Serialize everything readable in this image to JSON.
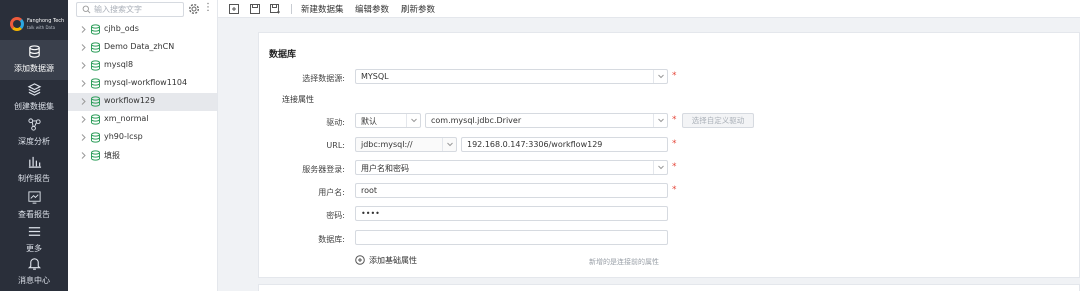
{
  "logo": {
    "name": "Fanghong Tech",
    "tagline": "talk with Data"
  },
  "nav": [
    {
      "label": "添加数据源",
      "icon": "database-icon",
      "active": true
    },
    {
      "label": "创建数据集",
      "icon": "layers-icon"
    },
    {
      "label": "深度分析",
      "icon": "network-icon"
    },
    {
      "label": "制作报告",
      "icon": "report-icon"
    },
    {
      "label": "查看报告",
      "icon": "chart-monitor-icon"
    },
    {
      "label": "更多",
      "icon": "menu-icon"
    },
    {
      "label": "消息中心",
      "icon": "bell-icon"
    }
  ],
  "tree": {
    "search_placeholder": "输入搜索文字",
    "more": "⋮",
    "items": [
      {
        "label": "cjhb_ods"
      },
      {
        "label": "Demo Data_zhCN"
      },
      {
        "label": "mysql8"
      },
      {
        "label": "mysql-workflow1104"
      },
      {
        "label": "workflow129",
        "selected": true
      },
      {
        "label": "xm_normal"
      },
      {
        "label": "yh90-lcsp"
      },
      {
        "label": "填报"
      }
    ]
  },
  "toolbar": {
    "new_dataset": "新建数据集",
    "edit_params": "编辑参数",
    "refresh_params": "刷新参数"
  },
  "form": {
    "title": "数据库",
    "section": "连接属性",
    "datasource_label": "选择数据源:",
    "datasource_value": "MYSQL",
    "driver_label": "驱动:",
    "driver_mode": "默认",
    "driver_class": "com.mysql.jdbc.Driver",
    "custom_driver_button": "选择自定义驱动",
    "url_label": "URL:",
    "url_prefix": "jdbc:mysql://",
    "url_value": "192.168.0.147:3306/workflow129",
    "login_label": "服务器登录:",
    "login_value": "用户名和密码",
    "username_label": "用户名:",
    "username_value": "root",
    "password_label": "密码:",
    "password_value": "••••",
    "database_label": "数据库:",
    "database_value": "",
    "add_attr": "添加基础属性",
    "hint": "新增的是连接前的属性",
    "required": "*"
  },
  "colors": {
    "nav_bg": "#2a2f3a",
    "required": "#e5483b"
  }
}
